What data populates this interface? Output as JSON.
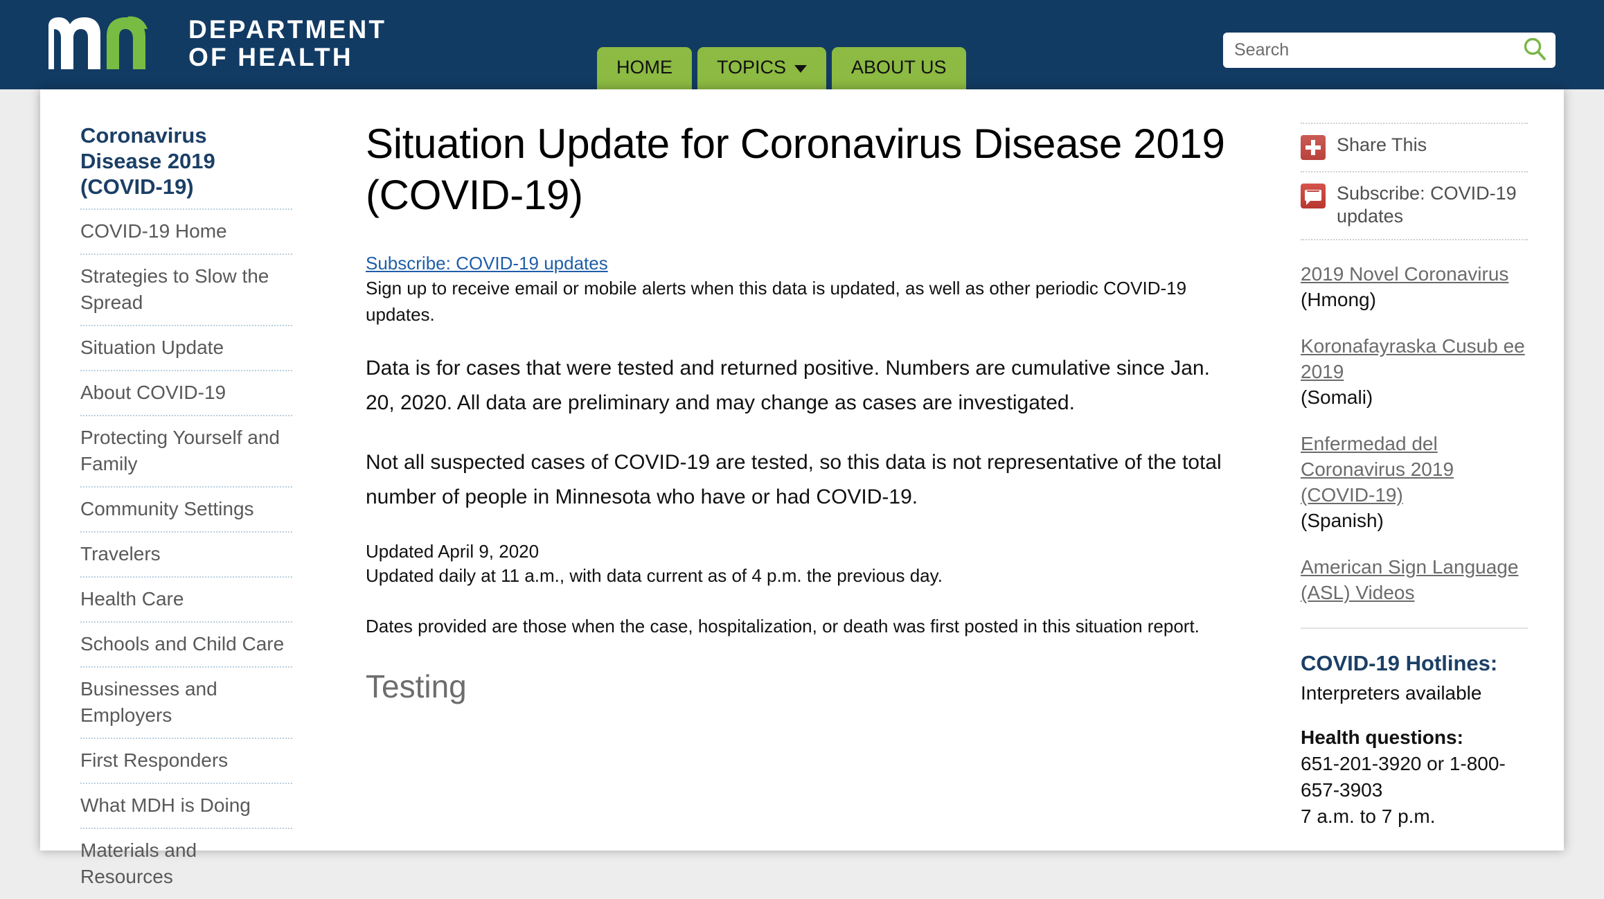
{
  "header": {
    "logo": {
      "mark_name": "mn-logo",
      "wordmark_line1": "DEPARTMENT",
      "wordmark_line2": "OF HEALTH"
    },
    "nav": [
      {
        "label": "HOME",
        "has_caret": false
      },
      {
        "label": "TOPICS",
        "has_caret": true
      },
      {
        "label": "ABOUT US",
        "has_caret": false
      }
    ],
    "search": {
      "placeholder": "Search",
      "value": "",
      "icon": "search-icon",
      "icon_color": "#7ab648"
    },
    "colors": {
      "bar": "#123b63",
      "accent_green": "#8cba42"
    }
  },
  "sidebar": {
    "title": "Coronavirus Disease 2019 (COVID-19)",
    "items": [
      {
        "label": "COVID-19 Home"
      },
      {
        "label": "Strategies to Slow the Spread"
      },
      {
        "label": "Situation Update"
      },
      {
        "label": "About COVID-19"
      },
      {
        "label": "Protecting Yourself and Family"
      },
      {
        "label": "Community Settings"
      },
      {
        "label": "Travelers"
      },
      {
        "label": "Health Care"
      },
      {
        "label": "Schools and Child Care"
      },
      {
        "label": "Businesses and Employers"
      },
      {
        "label": "First Responders"
      },
      {
        "label": "What MDH is Doing"
      },
      {
        "label": "Materials and Resources"
      }
    ]
  },
  "main": {
    "title": "Situation Update for Coronavirus Disease 2019 (COVID-19)",
    "subscribe_link": "Subscribe: COVID-19 updates",
    "subscribe_note": "Sign up to receive email or mobile alerts when this data is updated, as well as other periodic COVID-19 updates.",
    "paragraph_1": "Data is for cases that were tested and returned positive. Numbers are cumulative since Jan. 20, 2020. All data are preliminary and may change as cases are investigated.",
    "paragraph_2": "Not all suspected cases of COVID-19 are tested, so this data is not representative of the total number of people in Minnesota who have or had COVID-19.",
    "updated_date": "Updated April 9, 2020",
    "updated_schedule": "Updated daily at 11 a.m., with data current as of 4 p.m. the previous day.",
    "dates_note": "Dates provided are those when the case, hospitalization, or death was first posted in this situation report.",
    "section_heading": "Testing"
  },
  "rail": {
    "actions": [
      {
        "label": "Share This",
        "icon": "share-plus-icon"
      },
      {
        "label": "Subscribe: COVID-19 updates",
        "icon": "envelope-icon"
      }
    ],
    "languages": [
      {
        "link": "2019 Novel Coronavirus",
        "note": "(Hmong)"
      },
      {
        "link": "Koronafayraska Cusub ee 2019",
        "note": "(Somali)"
      },
      {
        "link": "Enfermedad del Coronavirus 2019 (COVID-19)",
        "note": "(Spanish)"
      },
      {
        "link": "American Sign Language (ASL) Videos",
        "note": ""
      }
    ],
    "hotlines": {
      "title": "COVID-19 Hotlines:",
      "interpreters": "Interpreters available",
      "health_label": "Health questions:",
      "health_numbers": "651-201-3920 or 1-800-657-3903",
      "health_hours": "7 a.m. to 7 p.m."
    }
  }
}
